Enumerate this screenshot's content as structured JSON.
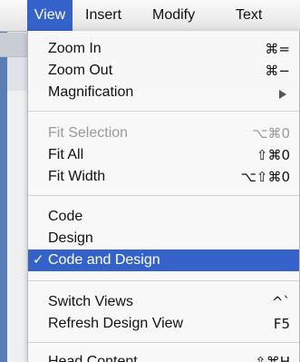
{
  "menubar": {
    "items": [
      {
        "label": "View",
        "active": true
      },
      {
        "label": "Insert"
      },
      {
        "label": "Modify"
      },
      {
        "label": "Text"
      }
    ]
  },
  "menu": {
    "items": [
      {
        "label": "Zoom In",
        "shortcut": "⌘=",
        "enabled": true
      },
      {
        "label": "Zoom Out",
        "shortcut": "⌘−",
        "enabled": true
      },
      {
        "label": "Magnification",
        "submenu": true,
        "enabled": true
      },
      {
        "label": "Fit Selection",
        "shortcut": "⌥⌘0",
        "enabled": false
      },
      {
        "label": "Fit All",
        "shortcut": "⇧⌘0",
        "enabled": true
      },
      {
        "label": "Fit Width",
        "shortcut": "⌥⇧⌘0",
        "enabled": true
      },
      {
        "label": "Code",
        "enabled": true
      },
      {
        "label": "Design",
        "enabled": true
      },
      {
        "label": "Code and Design",
        "checked": true,
        "highlighted": true,
        "check_mark": "✓"
      },
      {
        "label": "Switch Views",
        "shortcut": "^`",
        "enabled": true
      },
      {
        "label": "Refresh Design View",
        "shortcut": "F5",
        "enabled": true
      },
      {
        "label": "Head Content",
        "shortcut": "⇧⌘H",
        "enabled": true
      }
    ]
  },
  "colors": {
    "highlight": "#3562c9",
    "disabled_text": "#9a9a9a"
  }
}
